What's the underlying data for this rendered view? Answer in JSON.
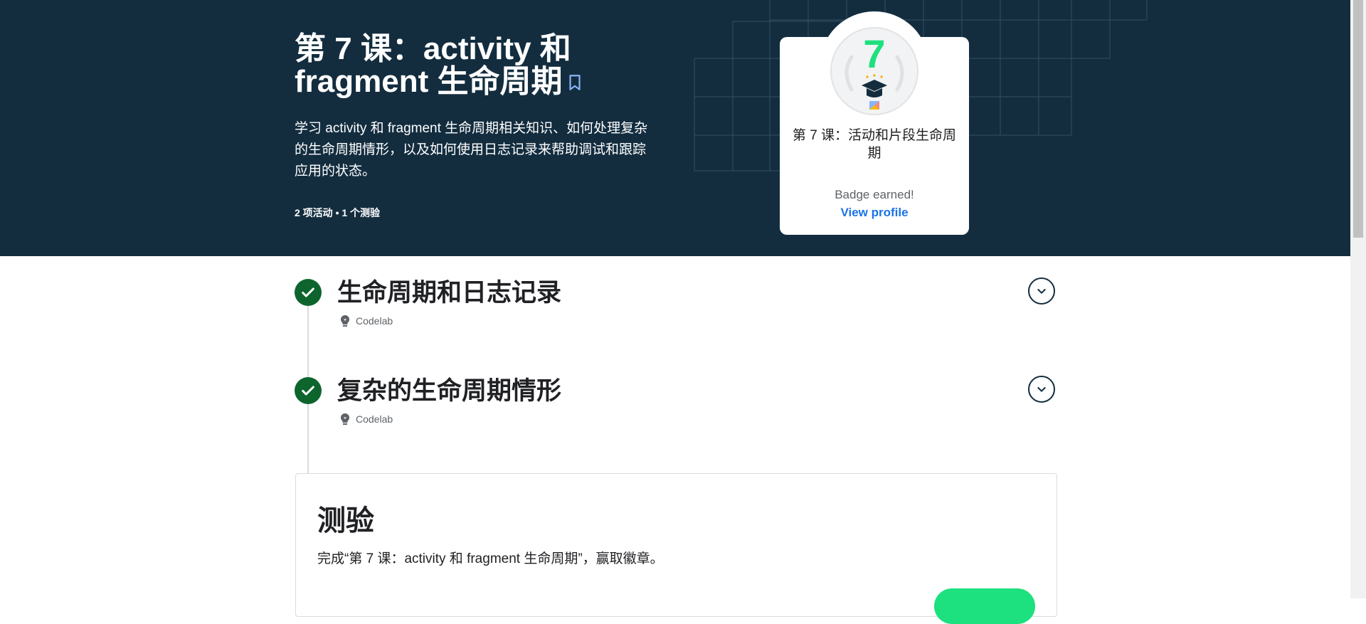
{
  "hero": {
    "title": "第 7 课：activity 和 fragment 生命周期",
    "description": "学习 activity 和 fragment 生命周期相关知识、如何处理复杂的生命周期情形，以及如何使用日志记录来帮助调试和跟踪应用的状态。",
    "meta": "2 项活动 • 1 个测验",
    "bookmark_icon": "bookmark-outline-icon",
    "background_color": "#132d3f"
  },
  "badge": {
    "number": "7",
    "title": "第 7 课：活动和片段生命周期",
    "status": "Badge earned!",
    "link": "View profile",
    "accent_color": "#1de07e",
    "link_color": "#1a73e8"
  },
  "activities": [
    {
      "title": "生命周期和日志记录",
      "type": "Codelab",
      "completed": true,
      "check_icon": "check-circle-icon",
      "expand_icon": "chevron-down-icon"
    },
    {
      "title": "复杂的生命周期情形",
      "type": "Codelab",
      "completed": true,
      "check_icon": "check-circle-icon",
      "expand_icon": "chevron-down-icon"
    }
  ],
  "quiz": {
    "title": "测验",
    "description": "完成“第 7 课：activity 和 fragment 生命周期”，赢取徽章。",
    "button_color": "#1de07e"
  }
}
